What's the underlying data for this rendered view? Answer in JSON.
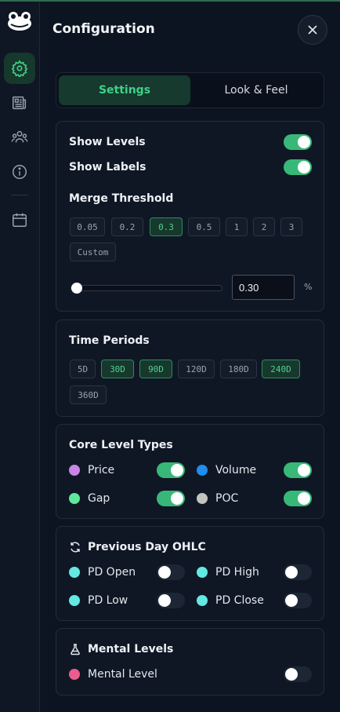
{
  "header": {
    "title": "Configuration"
  },
  "tabs": [
    {
      "label": "Settings",
      "active": true
    },
    {
      "label": "Look & Feel",
      "active": false
    }
  ],
  "levels": {
    "show_levels": {
      "label": "Show Levels",
      "on": true
    },
    "show_labels": {
      "label": "Show Labels",
      "on": true
    },
    "merge_title": "Merge Threshold",
    "merge_options": [
      "0.05",
      "0.2",
      "0.3",
      "0.5",
      "1",
      "2",
      "3",
      "Custom"
    ],
    "merge_selected": "0.3",
    "slider_value": 0.3,
    "slider_min": 0.3,
    "slider_max": 10,
    "input_value": "0.30",
    "unit": "%"
  },
  "periods": {
    "title": "Time Periods",
    "options": [
      {
        "label": "5D",
        "active": false
      },
      {
        "label": "30D",
        "active": true
      },
      {
        "label": "90D",
        "active": true
      },
      {
        "label": "120D",
        "active": false
      },
      {
        "label": "180D",
        "active": false
      },
      {
        "label": "240D",
        "active": true
      },
      {
        "label": "360D",
        "active": false
      }
    ]
  },
  "core": {
    "title": "Core Level Types",
    "items": [
      {
        "label": "Price",
        "color": "#c985e6",
        "on": true
      },
      {
        "label": "Volume",
        "color": "#1e8ef0",
        "on": true
      },
      {
        "label": "Gap",
        "color": "#5ee89c",
        "on": true
      },
      {
        "label": "POC",
        "color": "#c2c4c0",
        "on": true
      }
    ]
  },
  "ohlc": {
    "title": "Previous Day OHLC",
    "icon": "refresh-icon",
    "items": [
      {
        "label": "PD Open",
        "color": "#63e9e3",
        "on": false
      },
      {
        "label": "PD High",
        "color": "#63e9e3",
        "on": false
      },
      {
        "label": "PD Low",
        "color": "#63e9e3",
        "on": false
      },
      {
        "label": "PD Close",
        "color": "#63e9e3",
        "on": false
      }
    ]
  },
  "mental": {
    "title": "Mental Levels",
    "icon": "flask-icon",
    "item": {
      "label": "Mental Level",
      "color": "#ec5c8c",
      "on": false
    }
  },
  "colors": {
    "accent": "#38b878",
    "background": "#0d1421"
  }
}
